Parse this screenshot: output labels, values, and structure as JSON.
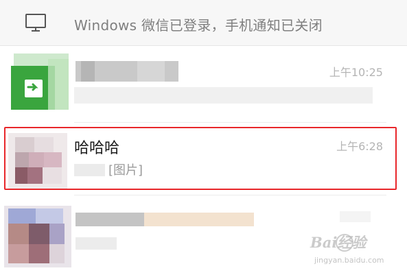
{
  "notification_banner": {
    "text": "Windows 微信已登录，手机通知已关闭",
    "icon": "monitor-icon"
  },
  "chats": [
    {
      "name": "",
      "time": "上午10:25",
      "preview": "",
      "avatar": "green-file-transfer-avatar"
    },
    {
      "name": "哈哈哈",
      "time": "上午6:28",
      "preview": "[图片]",
      "avatar": "pixelated-avatar"
    },
    {
      "name": "",
      "time": "",
      "preview": "",
      "avatar": "pixelated-avatar"
    }
  ],
  "highlight_color": "#e8262a",
  "watermark": {
    "brand": "Bai经验",
    "url": "jingyan.baidu.com"
  }
}
